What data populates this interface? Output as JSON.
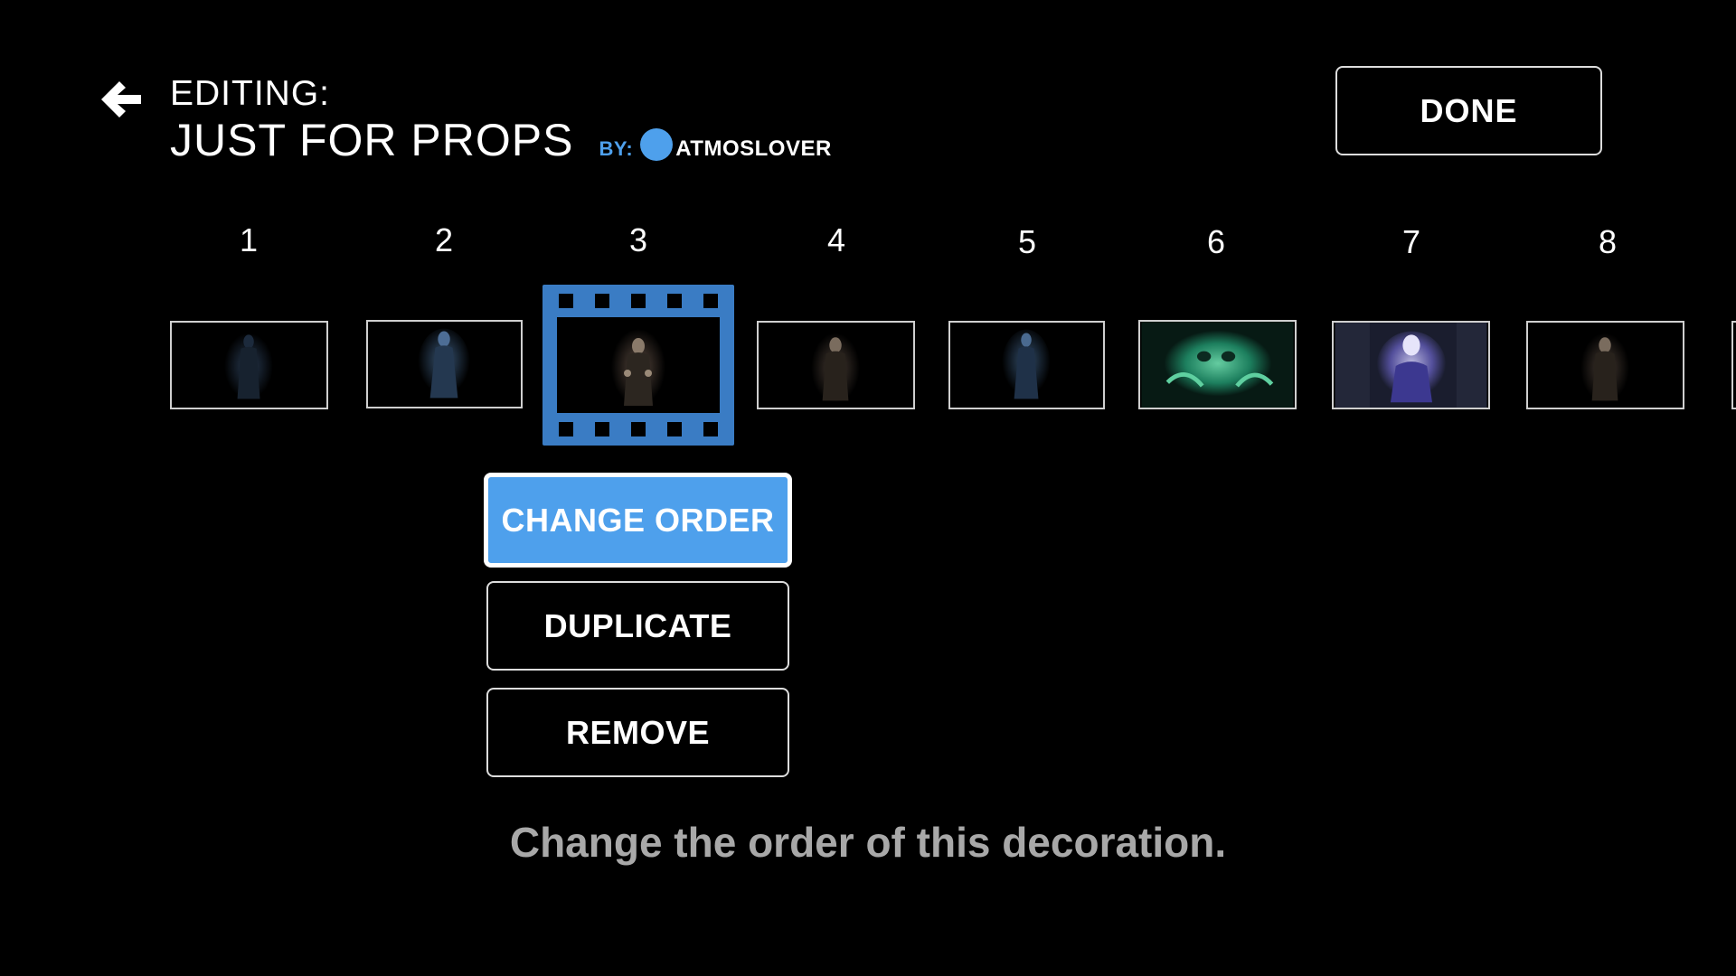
{
  "header": {
    "editing_label": "EDITING:",
    "playlist_title": "JUST FOR PROPS",
    "by_label": "BY:",
    "author_name": "ATMOSLOVER",
    "back_icon": "arrow-left-icon",
    "accent_color": "#4ea0ec"
  },
  "done_button": {
    "label": "DONE"
  },
  "timeline": {
    "items": [
      {
        "number": "1",
        "theme": "dark-figure-blue"
      },
      {
        "number": "2",
        "theme": "dark-figure-blue"
      },
      {
        "number": "3",
        "theme": "witch",
        "selected": true
      },
      {
        "number": "4",
        "theme": "witch"
      },
      {
        "number": "5",
        "theme": "dark-figure-blue"
      },
      {
        "number": "6",
        "theme": "green-ghost"
      },
      {
        "number": "7",
        "theme": "purple-ghost"
      },
      {
        "number": "8",
        "theme": "witch"
      }
    ],
    "selected_icon": "film-strip-icon",
    "selected_color": "#3a7cc4"
  },
  "actions": {
    "change_order": "CHANGE ORDER",
    "duplicate": "DUPLICATE",
    "remove": "REMOVE"
  },
  "hint_text": "Change the order of this decoration."
}
